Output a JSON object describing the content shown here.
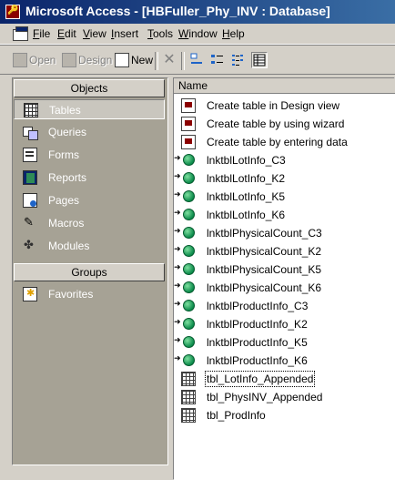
{
  "window": {
    "title": "Microsoft Access - [HBFuller_Phy_INV : Database]"
  },
  "menu": [
    "File",
    "Edit",
    "View",
    "Insert",
    "Tools",
    "Window",
    "Help"
  ],
  "menu_hotkeys": [
    "F",
    "E",
    "V",
    "I",
    "T",
    "W",
    "H"
  ],
  "toolbar": {
    "open": "Open",
    "design": "Design",
    "new": "New"
  },
  "objects_bar": {
    "header": "Objects",
    "items": [
      {
        "label": "Tables",
        "icon": "table-icon",
        "selected": true
      },
      {
        "label": "Queries",
        "icon": "query-icon"
      },
      {
        "label": "Forms",
        "icon": "form-icon"
      },
      {
        "label": "Reports",
        "icon": "report-icon"
      },
      {
        "label": "Pages",
        "icon": "page-icon"
      },
      {
        "label": "Macros",
        "icon": "macro-icon"
      },
      {
        "label": "Modules",
        "icon": "module-icon"
      }
    ],
    "groups_header": "Groups",
    "groups": [
      {
        "label": "Favorites",
        "icon": "favorites-icon"
      }
    ]
  },
  "list": {
    "column": "Name",
    "items": [
      {
        "label": "Create table in Design view",
        "icon": "wizard-shortcut-icon"
      },
      {
        "label": "Create table by using wizard",
        "icon": "wizard-shortcut-icon"
      },
      {
        "label": "Create table by entering data",
        "icon": "wizard-shortcut-icon"
      },
      {
        "label": "lnktblLotInfo_C3",
        "icon": "linked-table-icon"
      },
      {
        "label": "lnktblLotInfo_K2",
        "icon": "linked-table-icon"
      },
      {
        "label": "lnktblLotInfo_K5",
        "icon": "linked-table-icon"
      },
      {
        "label": "lnktblLotInfo_K6",
        "icon": "linked-table-icon"
      },
      {
        "label": "lnktblPhysicalCount_C3",
        "icon": "linked-table-icon"
      },
      {
        "label": "lnktblPhysicalCount_K2",
        "icon": "linked-table-icon"
      },
      {
        "label": "lnktblPhysicalCount_K5",
        "icon": "linked-table-icon"
      },
      {
        "label": "lnktblPhysicalCount_K6",
        "icon": "linked-table-icon"
      },
      {
        "label": "lnktblProductInfo_C3",
        "icon": "linked-table-icon"
      },
      {
        "label": "lnktblProductInfo_K2",
        "icon": "linked-table-icon"
      },
      {
        "label": "lnktblProductInfo_K5",
        "icon": "linked-table-icon"
      },
      {
        "label": "lnktblProductInfo_K6",
        "icon": "linked-table-icon"
      },
      {
        "label": "tbl_LotInfo_Appended",
        "icon": "local-table-icon",
        "focused": true
      },
      {
        "label": "tbl_PhysINV_Appended",
        "icon": "local-table-icon"
      },
      {
        "label": "tbl_ProdInfo",
        "icon": "local-table-icon"
      }
    ]
  },
  "colors": {
    "title_start": "#0a246a",
    "title_end": "#3a6ea5",
    "objbar_bg": "#a6a295",
    "face": "#d4d0c8"
  }
}
